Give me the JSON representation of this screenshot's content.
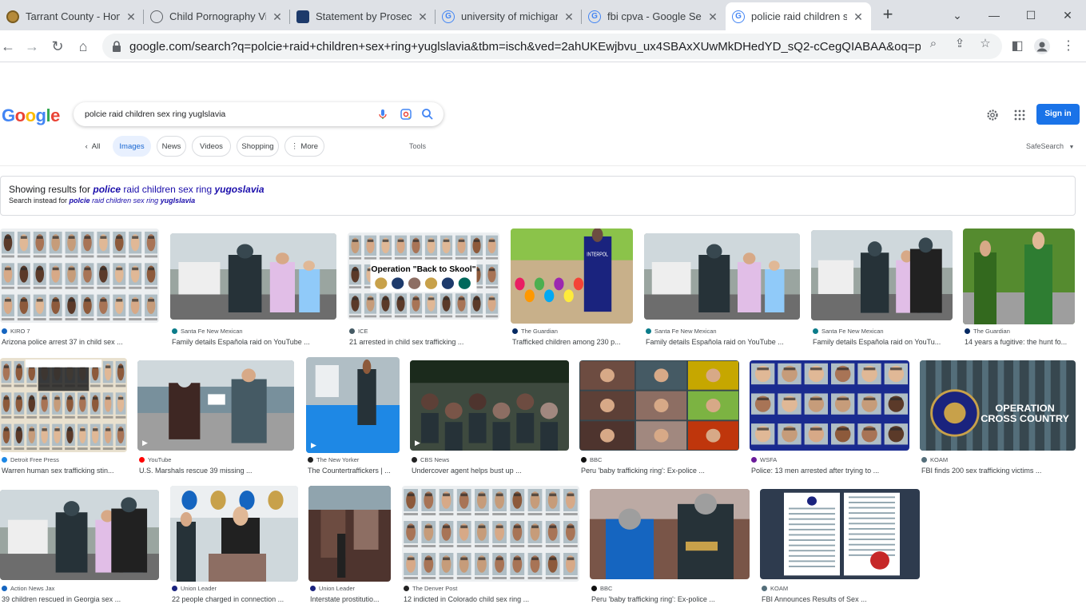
{
  "browser": {
    "tabs": [
      {
        "title": "Tarrant County - Home",
        "favicon": "county-seal-icon"
      },
      {
        "title": "Child Pornography Vic",
        "favicon": "globe-icon"
      },
      {
        "title": "Statement by Prosecut",
        "favicon": "icc-icon"
      },
      {
        "title": "university of michigan",
        "favicon": "google-g-icon"
      },
      {
        "title": "fbi cpva - Google Sear",
        "favicon": "google-g-icon"
      },
      {
        "title": "policie raid children se",
        "favicon": "google-g-icon"
      }
    ],
    "new_tab_label": "+",
    "url": "google.com/search?q=polcie+raid+children+sex+ring+yuglslavia&tbm=isch&ved=2ahUKEwjbvu_ux4SBAxXUwMkDHedYD_sQ2-cCegQIABAA&oq=polcie+rai..."
  },
  "google": {
    "logo": "Google",
    "query": "polcie raid children sex ring yuglslavia",
    "sign_in": "Sign in",
    "back_chip": "All",
    "chips": [
      "Images",
      "News",
      "Videos",
      "Shopping",
      "More"
    ],
    "tools": "Tools",
    "safesearch": "SafeSearch"
  },
  "correction": {
    "showing_prefix": "Showing results for ",
    "corrected_word1": "police",
    "corrected_mid": " raid children sex ring ",
    "corrected_word2": "yugoslavia",
    "instead_prefix": "Search instead for ",
    "orig_word1": "polcie",
    "orig_mid": " raid children sex ring ",
    "orig_word2": "yuglslavia"
  },
  "results": [
    {
      "source": "KIRO 7",
      "title": "Arizona police arrest 37 in child sex ..."
    },
    {
      "source": "Santa Fe New Mexican",
      "title": "Family details Española raid on YouTube ..."
    },
    {
      "source": "ICE",
      "title": "21 arrested in child sex trafficking ...",
      "image_text": "Operation \"Back to Skool\""
    },
    {
      "source": "The Guardian",
      "title": "Trafficked children among 230 p...",
      "image_text": "INTERPOL"
    },
    {
      "source": "Santa Fe New Mexican",
      "title": "Family details Española raid on YouTube ..."
    },
    {
      "source": "Santa Fe New Mexican",
      "title": "Family details Española raid on YouTu..."
    },
    {
      "source": "The Guardian",
      "title": "14 years a fugitive: the hunt fo..."
    },
    {
      "source": "Detroit Free Press",
      "title": "Warren human sex trafficking stin..."
    },
    {
      "source": "YouTube",
      "title": "U.S. Marshals rescue 39 missing ..."
    },
    {
      "source": "The New Yorker",
      "title": "The Countertraffickers | ..."
    },
    {
      "source": "CBS News",
      "title": "Undercover agent helps bust up ..."
    },
    {
      "source": "BBC",
      "title": "Peru 'baby trafficking ring': Ex-police ..."
    },
    {
      "source": "WSFA",
      "title": "Police: 13 men arrested after trying to ..."
    },
    {
      "source": "KOAM",
      "title": "FBI finds 200 sex trafficking victims ...",
      "image_text": "OPERATION CROSS COUNTRY"
    },
    {
      "source": "Action News Jax",
      "title": "39 children rescued in Georgia sex ..."
    },
    {
      "source": "Union Leader",
      "title": "22 people charged in connection ..."
    },
    {
      "source": "Union Leader",
      "title": "Interstate prostitutio..."
    },
    {
      "source": "The Denver Post",
      "title": "12 indicted in Colorado child sex ring ..."
    },
    {
      "source": "BBC",
      "title": "Peru 'baby trafficking ring': Ex-police ..."
    },
    {
      "source": "KOAM",
      "title": "FBI Announces Results of Sex ..."
    }
  ]
}
